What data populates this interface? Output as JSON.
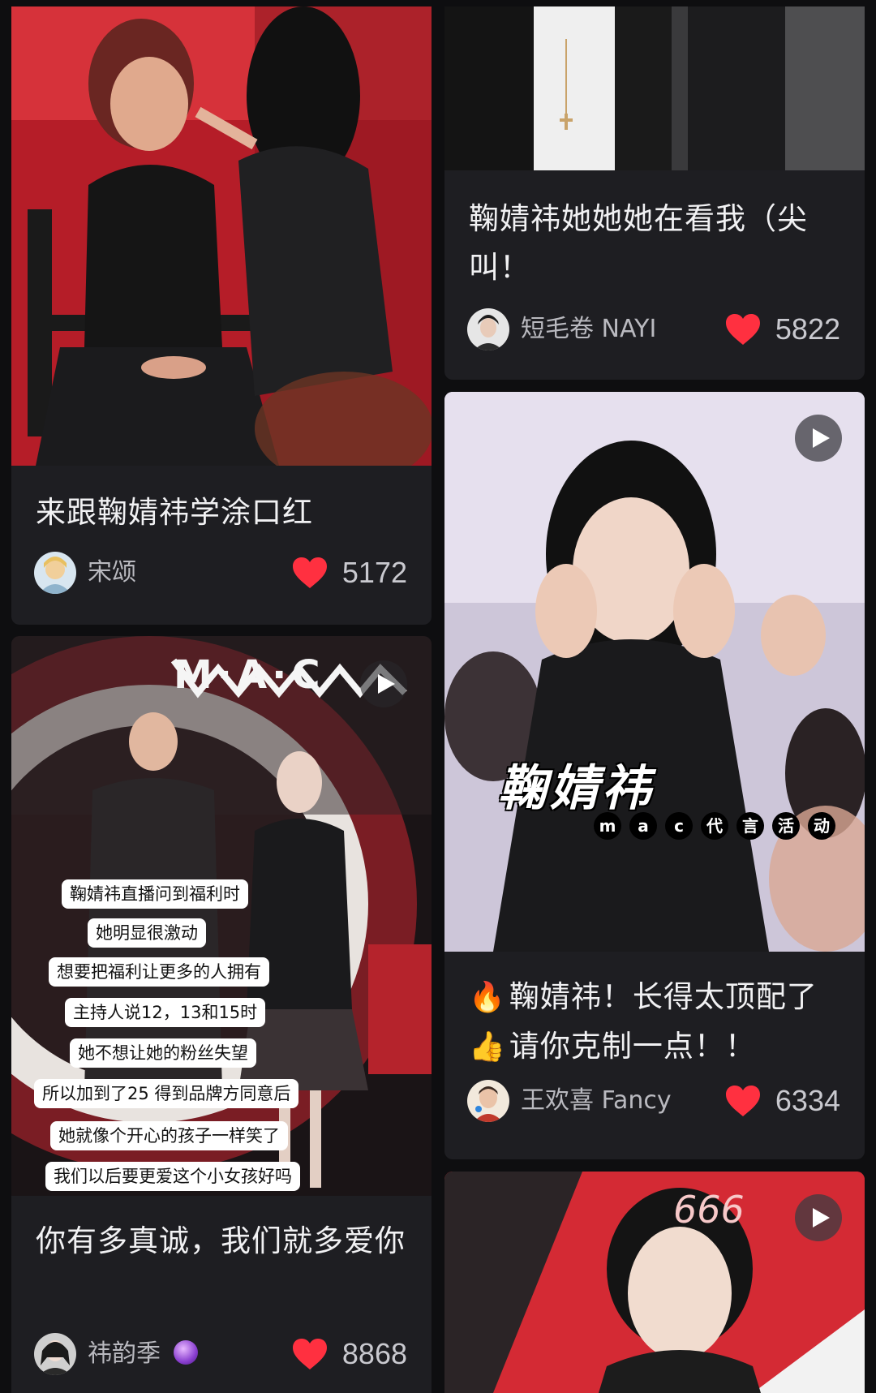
{
  "colors": {
    "background": "#0e0e10",
    "card": "#1e1e22",
    "heart": "#ff3040",
    "title_text": "#f1f1f3",
    "meta_text": "#b9b9bf"
  },
  "cards": [
    {
      "title": "来跟鞠婧祎学涂口红",
      "author": "宋颂",
      "likes": "5172",
      "has_video": false
    },
    {
      "title": "你有多真诚，我们就多爱你",
      "author": "祎韵季",
      "author_badge_icon": "crystal-ball-icon",
      "likes": "8868",
      "has_video": true,
      "overlay_brand": "M·A·C",
      "subtitles": [
        "鞠婧祎直播问到福利时",
        "她明显很激动",
        "想要把福利让更多的人拥有",
        "主持人说12，13和15时",
        "她不想让她的粉丝失望",
        "所以加到了25 得到品牌方同意后",
        "她就像个开心的孩子一样笑了",
        "我们以后要更爱这个小女孩好吗"
      ]
    },
    {
      "title": "鞠婧祎她她她在看我（尖叫！",
      "author": "短毛卷 NAYI",
      "likes": "5822",
      "has_video": false
    },
    {
      "title_line1": "鞠婧祎！长得太顶配了",
      "title_line2": "请你克制一点！！",
      "title_icon1": "fire-icon",
      "title_icon2": "thumbs-up-icon",
      "author": "王欢喜 Fancy",
      "likes": "6334",
      "has_video": true,
      "overlay_title": "鞠婧祎",
      "overlay_tag": [
        "m",
        "a",
        "c",
        "代",
        "言",
        "活",
        "动"
      ]
    },
    {
      "has_video": true,
      "overlay_number": "666"
    }
  ]
}
